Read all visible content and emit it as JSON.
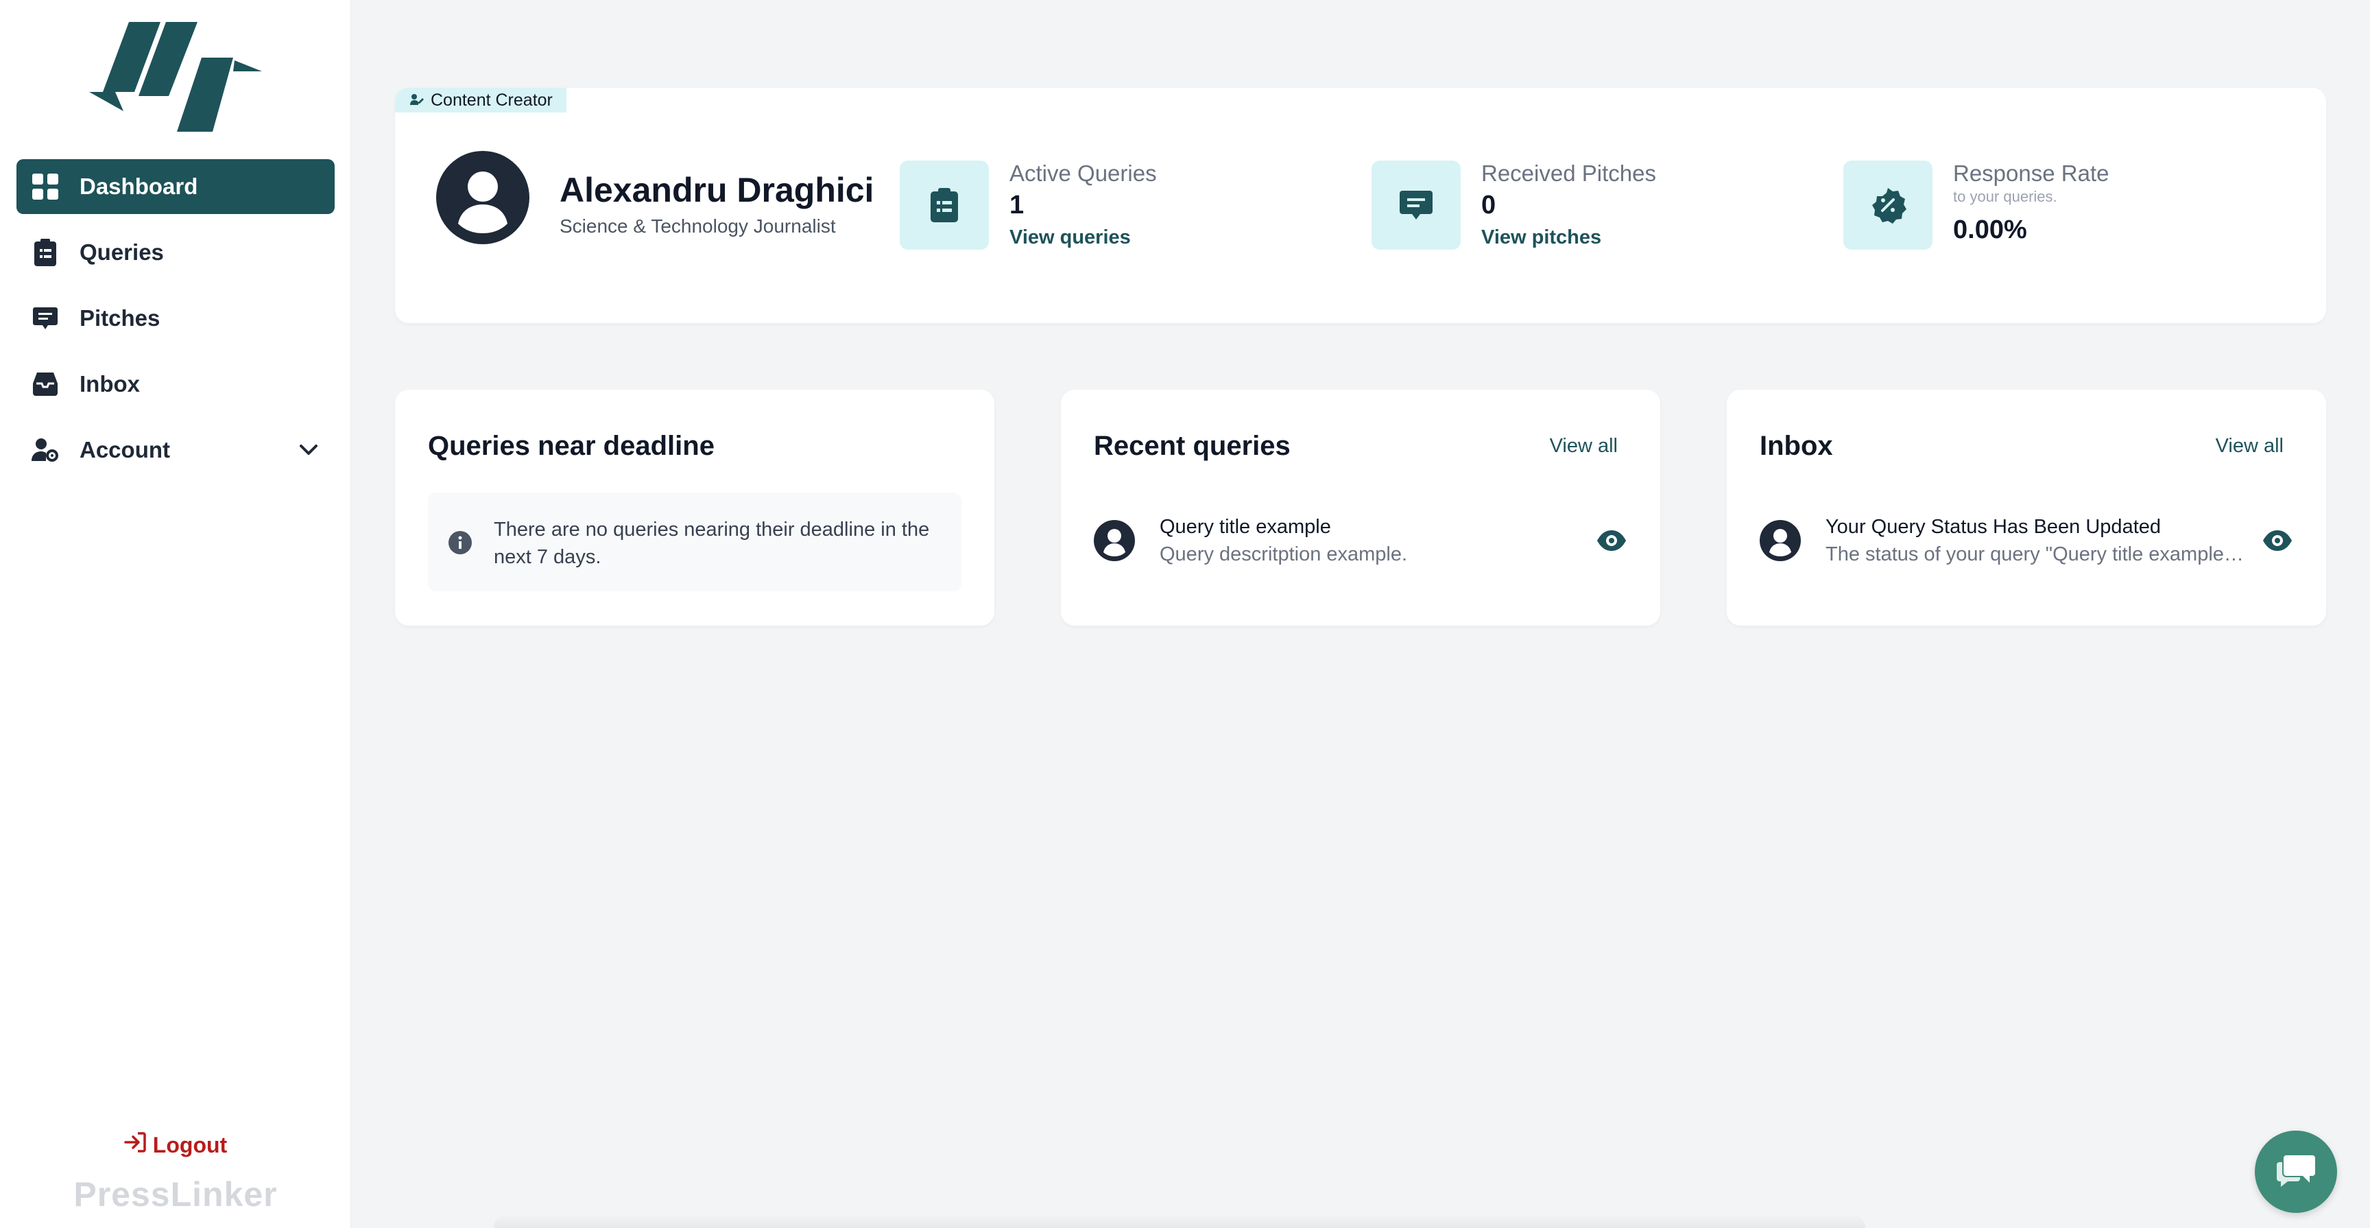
{
  "brand": {
    "name": "PressLinker",
    "accent": "#1e535a",
    "accent_light": "#d8f3f5"
  },
  "sidebar": {
    "items": [
      {
        "label": "Dashboard",
        "icon": "grid-icon",
        "active": true
      },
      {
        "label": "Queries",
        "icon": "clipboard-icon",
        "active": false
      },
      {
        "label": "Pitches",
        "icon": "message-icon",
        "active": false
      },
      {
        "label": "Inbox",
        "icon": "inbox-icon",
        "active": false
      },
      {
        "label": "Account",
        "icon": "user-gear-icon",
        "active": false,
        "expandable": true
      }
    ],
    "logout_label": "Logout"
  },
  "profile": {
    "role_badge": "Content Creator",
    "name": "Alexandru Draghici",
    "subtitle": "Science & Technology Journalist"
  },
  "stats": {
    "active_queries": {
      "label": "Active Queries",
      "value": "1",
      "link": "View queries",
      "icon": "clipboard-icon"
    },
    "received_pitches": {
      "label": "Received Pitches",
      "value": "0",
      "link": "View pitches",
      "icon": "message-icon"
    },
    "response_rate": {
      "label": "Response Rate",
      "sublabel": "to your queries.",
      "value": "0.00%",
      "icon": "percent-badge-icon"
    }
  },
  "cards": {
    "deadline": {
      "title": "Queries near deadline",
      "notice": "There are no queries nearing their deadline in the next 7 days."
    },
    "recent": {
      "title": "Recent queries",
      "link": "View all",
      "items": [
        {
          "title": "Query title example",
          "description": "Query descritption example."
        }
      ]
    },
    "inbox": {
      "title": "Inbox",
      "link": "View all",
      "items": [
        {
          "title": "Your Query Status Has Been Updated",
          "description": "The status of your query \"Query title example\" has been updated."
        }
      ]
    }
  }
}
